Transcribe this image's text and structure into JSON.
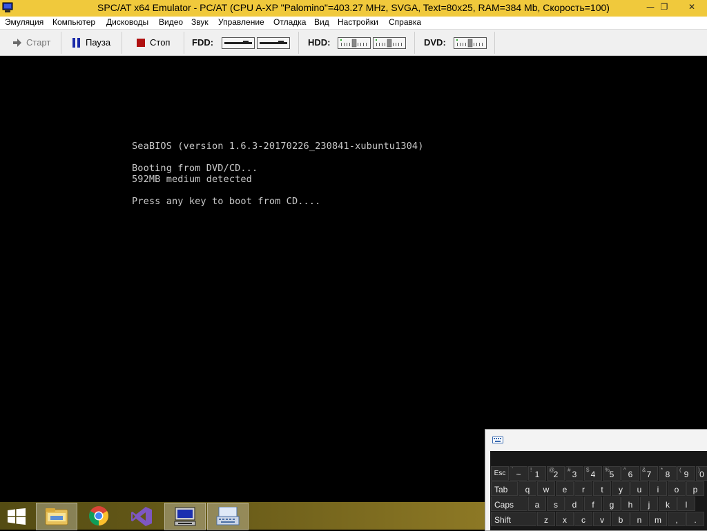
{
  "window": {
    "title": "SPC/AT x64 Emulator - PC/AT (CPU A-XP \"Palomino\"=403.27 MHz, SVGA, Text=80x25, RAM=384 Mb, Скорость=100)",
    "minimize_glyph": "—",
    "restore_glyph": "❐",
    "close_glyph": "✕"
  },
  "menu": {
    "items": [
      "Эмуляция",
      "Компьютер",
      "Дисководы",
      "Видео",
      "Звук",
      "Управление",
      "Отладка",
      "Вид",
      "Настройки",
      "Справка"
    ]
  },
  "toolbar": {
    "start_label": "Старт",
    "pause_label": "Пауза",
    "stop_label": "Стоп",
    "fdd_label": "FDD:",
    "hdd_label": "HDD:",
    "dvd_label": "DVD:",
    "colors": {
      "pause_icon": "#1a2aa8",
      "stop_icon": "#b01010",
      "start_icon": "#6a6a6a",
      "led_green": "#2aa82a"
    }
  },
  "screen": {
    "lines": [
      "SeaBIOS (version 1.6.3-20170226_230841-xubuntu1304)",
      "Booting from DVD/CD...",
      "592MB medium detected",
      "Press any key to boot from CD...."
    ]
  },
  "taskbar": {
    "apps": [
      "start-icon",
      "file-explorer-icon",
      "chrome-icon",
      "visual-studio-icon",
      "emulator-icon",
      "on-screen-keyboard-icon"
    ]
  },
  "keyboard": {
    "row1": [
      {
        "main": "Esc",
        "sup": ""
      },
      {
        "main": "~",
        "sup": "`"
      },
      {
        "main": "1",
        "sup": "!"
      },
      {
        "main": "2",
        "sup": "@"
      },
      {
        "main": "3",
        "sup": "#"
      },
      {
        "main": "4",
        "sup": "$"
      },
      {
        "main": "5",
        "sup": "%"
      },
      {
        "main": "6",
        "sup": "^"
      },
      {
        "main": "7",
        "sup": "&"
      },
      {
        "main": "8",
        "sup": "*"
      },
      {
        "main": "9",
        "sup": "("
      },
      {
        "main": "0",
        "sup": ")"
      }
    ],
    "row2": [
      "Tab",
      "q",
      "w",
      "e",
      "r",
      "t",
      "y",
      "u",
      "i",
      "o",
      "p"
    ],
    "row3": [
      "Caps",
      "a",
      "s",
      "d",
      "f",
      "g",
      "h",
      "j",
      "k",
      "l"
    ],
    "row4": [
      "Shift",
      "z",
      "x",
      "c",
      "v",
      "b",
      "n",
      "m",
      ",",
      "."
    ]
  }
}
